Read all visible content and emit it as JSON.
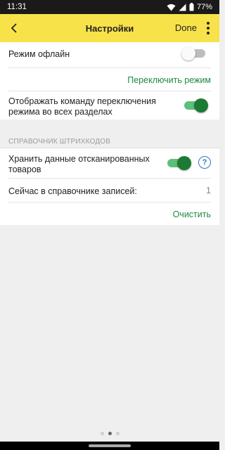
{
  "status_bar": {
    "time": "11:31",
    "battery_percent": "77%",
    "icons": [
      "wifi-icon",
      "signal-icon",
      "battery-icon"
    ]
  },
  "app_bar": {
    "title": "Настройки",
    "done_label": "Done",
    "back_icon": "chevron-left-icon",
    "more_icon": "more-vertical-icon"
  },
  "settings": {
    "offline_mode": {
      "label": "Режим офлайн",
      "enabled": false
    },
    "switch_mode_link": "Переключить режим",
    "show_switch_command": {
      "label_line1": "Отображать команду переключения",
      "label_line2": "режима во всех разделах",
      "enabled": true
    }
  },
  "barcode_section": {
    "header": "СПРАВОЧНИК ШТРИХКОДОВ",
    "store_scanned": {
      "label_line1": "Хранить данные отсканированных",
      "label_line2": "товаров",
      "enabled": true
    },
    "help_icon": "question-circle-icon",
    "records_label": "Сейчас в справочнике записей:",
    "records_count": "1",
    "clear_link": "Очистить"
  },
  "page_indicator": {
    "total": 3,
    "active_index": 1
  },
  "colors": {
    "app_bar": "#f7e24a",
    "accent_green": "#1b7a34",
    "link_green": "#1e8a3e",
    "help_blue": "#2f77c6",
    "background": "#efefef"
  }
}
